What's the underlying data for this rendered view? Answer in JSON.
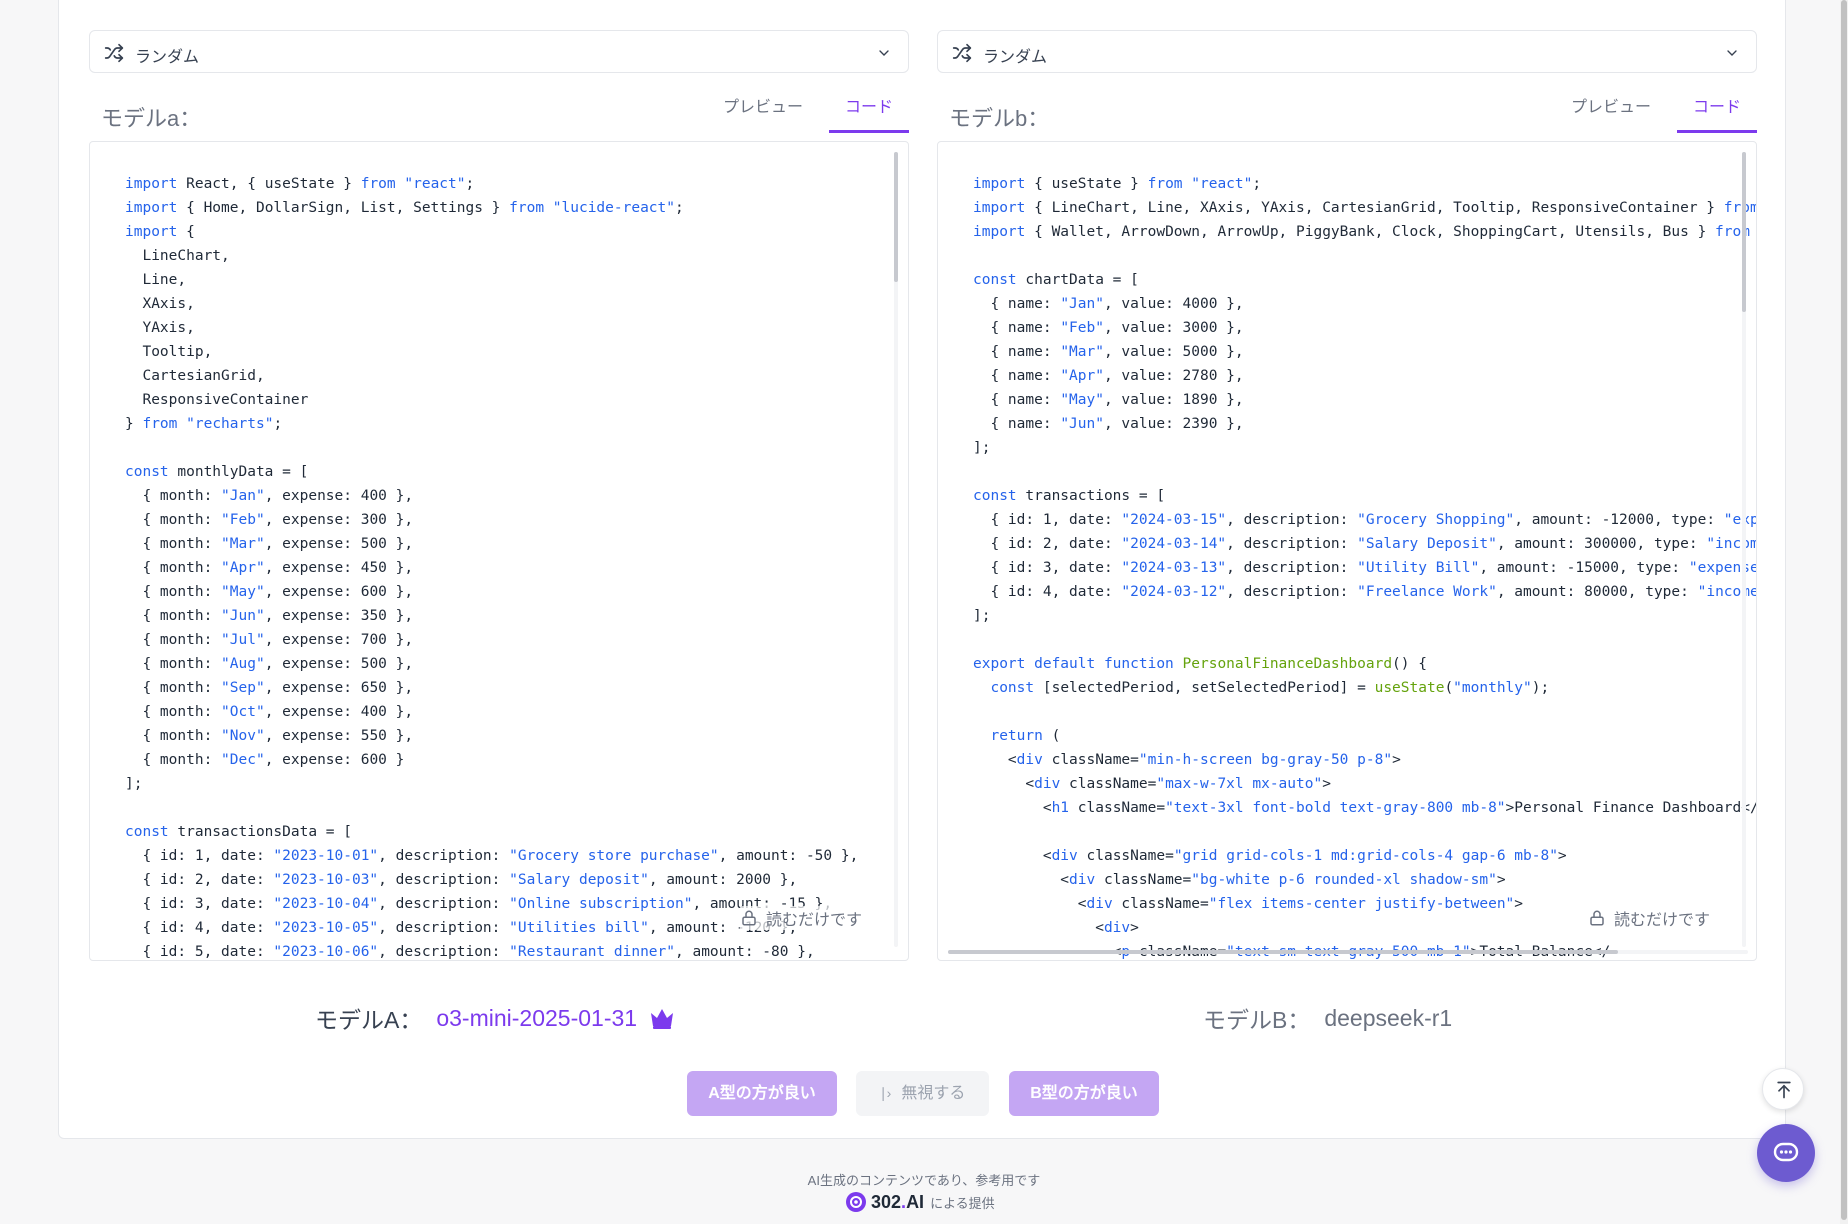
{
  "colA": {
    "select_label": "ランダム",
    "model_label": "モデルa：",
    "tabs": [
      "プレビュー",
      "コード"
    ],
    "readonly_label": "読むだけです",
    "code_lines": [
      [
        [
          "k",
          "import"
        ],
        [
          "t",
          " React, { useState } "
        ],
        [
          "k",
          "from"
        ],
        [
          "t",
          " "
        ],
        [
          "s",
          "\"react\""
        ],
        [
          "t",
          ";"
        ]
      ],
      [
        [
          "k",
          "import"
        ],
        [
          "t",
          " { Home, DollarSign, List, Settings } "
        ],
        [
          "k",
          "from"
        ],
        [
          "t",
          " "
        ],
        [
          "s",
          "\"lucide-react\""
        ],
        [
          "t",
          ";"
        ]
      ],
      [
        [
          "k",
          "import"
        ],
        [
          "t",
          " {"
        ]
      ],
      [
        [
          "t",
          "  LineChart,"
        ]
      ],
      [
        [
          "t",
          "  Line,"
        ]
      ],
      [
        [
          "t",
          "  XAxis,"
        ]
      ],
      [
        [
          "t",
          "  YAxis,"
        ]
      ],
      [
        [
          "t",
          "  Tooltip,"
        ]
      ],
      [
        [
          "t",
          "  CartesianGrid,"
        ]
      ],
      [
        [
          "t",
          "  ResponsiveContainer"
        ]
      ],
      [
        [
          "t",
          "} "
        ],
        [
          "k",
          "from"
        ],
        [
          "t",
          " "
        ],
        [
          "s",
          "\"recharts\""
        ],
        [
          "t",
          ";"
        ]
      ],
      [
        [
          "t",
          ""
        ]
      ],
      [
        [
          "k",
          "const"
        ],
        [
          "t",
          " monthlyData = ["
        ]
      ],
      [
        [
          "t",
          "  { month: "
        ],
        [
          "s",
          "\"Jan\""
        ],
        [
          "t",
          ", expense: 400 },"
        ]
      ],
      [
        [
          "t",
          "  { month: "
        ],
        [
          "s",
          "\"Feb\""
        ],
        [
          "t",
          ", expense: 300 },"
        ]
      ],
      [
        [
          "t",
          "  { month: "
        ],
        [
          "s",
          "\"Mar\""
        ],
        [
          "t",
          ", expense: 500 },"
        ]
      ],
      [
        [
          "t",
          "  { month: "
        ],
        [
          "s",
          "\"Apr\""
        ],
        [
          "t",
          ", expense: 450 },"
        ]
      ],
      [
        [
          "t",
          "  { month: "
        ],
        [
          "s",
          "\"May\""
        ],
        [
          "t",
          ", expense: 600 },"
        ]
      ],
      [
        [
          "t",
          "  { month: "
        ],
        [
          "s",
          "\"Jun\""
        ],
        [
          "t",
          ", expense: 350 },"
        ]
      ],
      [
        [
          "t",
          "  { month: "
        ],
        [
          "s",
          "\"Jul\""
        ],
        [
          "t",
          ", expense: 700 },"
        ]
      ],
      [
        [
          "t",
          "  { month: "
        ],
        [
          "s",
          "\"Aug\""
        ],
        [
          "t",
          ", expense: 500 },"
        ]
      ],
      [
        [
          "t",
          "  { month: "
        ],
        [
          "s",
          "\"Sep\""
        ],
        [
          "t",
          ", expense: 650 },"
        ]
      ],
      [
        [
          "t",
          "  { month: "
        ],
        [
          "s",
          "\"Oct\""
        ],
        [
          "t",
          ", expense: 400 },"
        ]
      ],
      [
        [
          "t",
          "  { month: "
        ],
        [
          "s",
          "\"Nov\""
        ],
        [
          "t",
          ", expense: 550 },"
        ]
      ],
      [
        [
          "t",
          "  { month: "
        ],
        [
          "s",
          "\"Dec\""
        ],
        [
          "t",
          ", expense: 600 }"
        ]
      ],
      [
        [
          "t",
          "];"
        ]
      ],
      [
        [
          "t",
          ""
        ]
      ],
      [
        [
          "k",
          "const"
        ],
        [
          "t",
          " transactionsData = ["
        ]
      ],
      [
        [
          "t",
          "  { id: 1, date: "
        ],
        [
          "s",
          "\"2023-10-01\""
        ],
        [
          "t",
          ", description: "
        ],
        [
          "s",
          "\"Grocery store purchase\""
        ],
        [
          "t",
          ", amount: -50 },"
        ]
      ],
      [
        [
          "t",
          "  { id: 2, date: "
        ],
        [
          "s",
          "\"2023-10-03\""
        ],
        [
          "t",
          ", description: "
        ],
        [
          "s",
          "\"Salary deposit\""
        ],
        [
          "t",
          ", amount: 2000 },"
        ]
      ],
      [
        [
          "t",
          "  { id: 3, date: "
        ],
        [
          "s",
          "\"2023-10-04\""
        ],
        [
          "t",
          ", description: "
        ],
        [
          "s",
          "\"Online subscription\""
        ],
        [
          "t",
          ", amount: -15 },"
        ]
      ],
      [
        [
          "t",
          "  { id: 4, date: "
        ],
        [
          "s",
          "\"2023-10-05\""
        ],
        [
          "t",
          ", description: "
        ],
        [
          "s",
          "\"Utilities bill\""
        ],
        [
          "t",
          ", amount: -120 },"
        ]
      ],
      [
        [
          "t",
          "  { id: 5, date: "
        ],
        [
          "s",
          "\"2023-10-06\""
        ],
        [
          "t",
          ", description: "
        ],
        [
          "s",
          "\"Restaurant dinner\""
        ],
        [
          "t",
          ", amount: -80 },"
        ]
      ]
    ],
    "model_prefix": "モデルA：",
    "model_name": "o3-mini-2025-01-31"
  },
  "colB": {
    "select_label": "ランダム",
    "model_label": "モデルb：",
    "tabs": [
      "プレビュー",
      "コード"
    ],
    "readonly_label": "読むだけです",
    "code_lines": [
      [
        [
          "k",
          "import"
        ],
        [
          "t",
          " { useState } "
        ],
        [
          "k",
          "from"
        ],
        [
          "t",
          " "
        ],
        [
          "s",
          "\"react\""
        ],
        [
          "t",
          ";"
        ]
      ],
      [
        [
          "k",
          "import"
        ],
        [
          "t",
          " { LineChart, Line, XAxis, YAxis, CartesianGrid, Tooltip, ResponsiveContainer } "
        ],
        [
          "k",
          "from"
        ]
      ],
      [
        [
          "k",
          "import"
        ],
        [
          "t",
          " { Wallet, ArrowDown, ArrowUp, PiggyBank, Clock, ShoppingCart, Utensils, Bus } "
        ],
        [
          "k",
          "from"
        ]
      ],
      [
        [
          "t",
          ""
        ]
      ],
      [
        [
          "k",
          "const"
        ],
        [
          "t",
          " chartData = ["
        ]
      ],
      [
        [
          "t",
          "  { name: "
        ],
        [
          "s",
          "\"Jan\""
        ],
        [
          "t",
          ", value: 4000 },"
        ]
      ],
      [
        [
          "t",
          "  { name: "
        ],
        [
          "s",
          "\"Feb\""
        ],
        [
          "t",
          ", value: 3000 },"
        ]
      ],
      [
        [
          "t",
          "  { name: "
        ],
        [
          "s",
          "\"Mar\""
        ],
        [
          "t",
          ", value: 5000 },"
        ]
      ],
      [
        [
          "t",
          "  { name: "
        ],
        [
          "s",
          "\"Apr\""
        ],
        [
          "t",
          ", value: 2780 },"
        ]
      ],
      [
        [
          "t",
          "  { name: "
        ],
        [
          "s",
          "\"May\""
        ],
        [
          "t",
          ", value: 1890 },"
        ]
      ],
      [
        [
          "t",
          "  { name: "
        ],
        [
          "s",
          "\"Jun\""
        ],
        [
          "t",
          ", value: 2390 },"
        ]
      ],
      [
        [
          "t",
          "];"
        ]
      ],
      [
        [
          "t",
          ""
        ]
      ],
      [
        [
          "k",
          "const"
        ],
        [
          "t",
          " transactions = ["
        ]
      ],
      [
        [
          "t",
          "  { id: 1, date: "
        ],
        [
          "s",
          "\"2024-03-15\""
        ],
        [
          "t",
          ", description: "
        ],
        [
          "s",
          "\"Grocery Shopping\""
        ],
        [
          "t",
          ", amount: -12000, type: "
        ],
        [
          "s",
          "\"exp"
        ]
      ],
      [
        [
          "t",
          "  { id: 2, date: "
        ],
        [
          "s",
          "\"2024-03-14\""
        ],
        [
          "t",
          ", description: "
        ],
        [
          "s",
          "\"Salary Deposit\""
        ],
        [
          "t",
          ", amount: 300000, type: "
        ],
        [
          "s",
          "\"incom"
        ]
      ],
      [
        [
          "t",
          "  { id: 3, date: "
        ],
        [
          "s",
          "\"2024-03-13\""
        ],
        [
          "t",
          ", description: "
        ],
        [
          "s",
          "\"Utility Bill\""
        ],
        [
          "t",
          ", amount: -15000, type: "
        ],
        [
          "s",
          "\"expense"
        ]
      ],
      [
        [
          "t",
          "  { id: 4, date: "
        ],
        [
          "s",
          "\"2024-03-12\""
        ],
        [
          "t",
          ", description: "
        ],
        [
          "s",
          "\"Freelance Work\""
        ],
        [
          "t",
          ", amount: 80000, type: "
        ],
        [
          "s",
          "\"income"
        ]
      ],
      [
        [
          "t",
          "];"
        ]
      ],
      [
        [
          "t",
          ""
        ]
      ],
      [
        [
          "k",
          "export default function"
        ],
        [
          "t",
          " "
        ],
        [
          "f",
          "PersonalFinanceDashboard"
        ],
        [
          "t",
          "() {"
        ]
      ],
      [
        [
          "t",
          "  "
        ],
        [
          "k",
          "const"
        ],
        [
          "t",
          " [selectedPeriod, setSelectedPeriod] = "
        ],
        [
          "f",
          "useState"
        ],
        [
          "t",
          "("
        ],
        [
          "s",
          "\"monthly\""
        ],
        [
          "t",
          ");"
        ]
      ],
      [
        [
          "t",
          ""
        ]
      ],
      [
        [
          "t",
          "  "
        ],
        [
          "k",
          "return"
        ],
        [
          "t",
          " ("
        ]
      ],
      [
        [
          "t",
          "    <"
        ],
        [
          "k",
          "div"
        ],
        [
          "t",
          " className="
        ],
        [
          "s",
          "\"min-h-screen bg-gray-50 p-8\""
        ],
        [
          "t",
          ">"
        ]
      ],
      [
        [
          "t",
          "      <"
        ],
        [
          "k",
          "div"
        ],
        [
          "t",
          " className="
        ],
        [
          "s",
          "\"max-w-7xl mx-auto\""
        ],
        [
          "t",
          ">"
        ]
      ],
      [
        [
          "t",
          "        <"
        ],
        [
          "k",
          "h1"
        ],
        [
          "t",
          " className="
        ],
        [
          "s",
          "\"text-3xl font-bold text-gray-800 mb-8\""
        ],
        [
          "t",
          ">Personal Finance Dashboard</"
        ]
      ],
      [
        [
          "t",
          ""
        ]
      ],
      [
        [
          "t",
          "        <"
        ],
        [
          "k",
          "div"
        ],
        [
          "t",
          " className="
        ],
        [
          "s",
          "\"grid grid-cols-1 md:grid-cols-4 gap-6 mb-8\""
        ],
        [
          "t",
          ">"
        ]
      ],
      [
        [
          "t",
          "          <"
        ],
        [
          "k",
          "div"
        ],
        [
          "t",
          " className="
        ],
        [
          "s",
          "\"bg-white p-6 rounded-xl shadow-sm\""
        ],
        [
          "t",
          ">"
        ]
      ],
      [
        [
          "t",
          "            <"
        ],
        [
          "k",
          "div"
        ],
        [
          "t",
          " className="
        ],
        [
          "s",
          "\"flex items-center justify-between\""
        ],
        [
          "t",
          ">"
        ]
      ],
      [
        [
          "t",
          "              <"
        ],
        [
          "k",
          "div"
        ],
        [
          "t",
          ">"
        ]
      ],
      [
        [
          "t",
          "                <"
        ],
        [
          "k",
          "p"
        ],
        [
          "t",
          " className="
        ],
        [
          "s",
          "\"text-sm text-gray-500 mb-1\""
        ],
        [
          "t",
          ">Total Balance</"
        ]
      ]
    ],
    "model_prefix": "モデルB：",
    "model_name": "deepseek-r1"
  },
  "actions": {
    "a_better": "A型の方が良い",
    "skip": "無視する",
    "b_better": "B型の方が良い"
  },
  "footer": {
    "disclaimer": "AI生成のコンテンツであり、参考用です",
    "brand_num": "302",
    "brand_dot": ".",
    "brand_ai": "AI",
    "provided_by": "による提供"
  },
  "colors": {
    "accent": "#7c3aed",
    "button_fill": "#c4a6f3",
    "chat_button": "#6d5bd0"
  },
  "icons": {
    "select": "shuffle-icon",
    "dropdown": "chevron-down-icon",
    "readonly": "lock-icon",
    "winner": "crown-icon",
    "skip": "skip-forward-icon",
    "scroll_top": "arrow-up-to-top-icon",
    "chat": "chat-bubble-icon"
  }
}
